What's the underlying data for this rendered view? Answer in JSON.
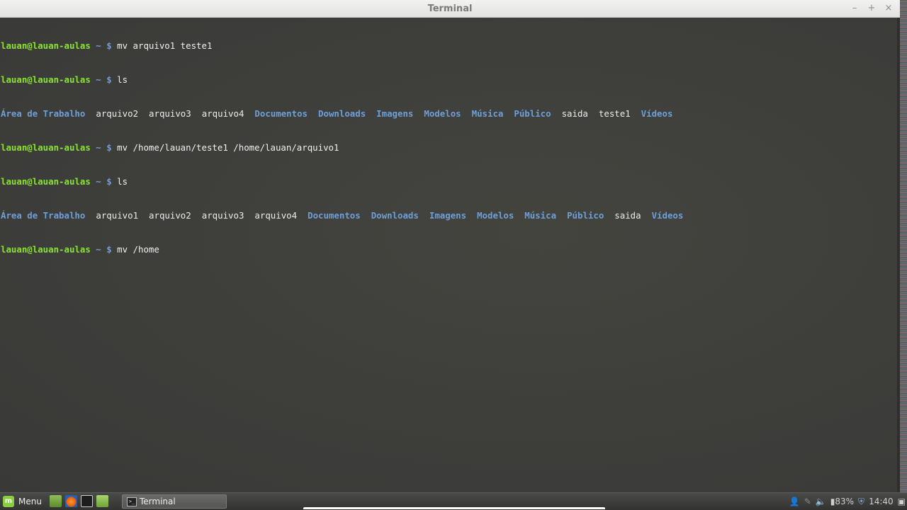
{
  "window": {
    "title": "Terminal",
    "controls": {
      "minimize": "–",
      "maximize": "+",
      "close": "×"
    }
  },
  "terminal": {
    "prompt_user": "lauan@lauan-aulas",
    "prompt_path": "~ $",
    "commands": [
      "mv arquivo1 teste1",
      "ls",
      "mv /home/lauan/teste1 /home/lauan/arquivo1",
      "ls",
      "mv /home"
    ],
    "ls1": [
      {
        "name": "Área de Trabalho",
        "type": "dir"
      },
      {
        "name": "arquivo2",
        "type": "file"
      },
      {
        "name": "arquivo3",
        "type": "file"
      },
      {
        "name": "arquivo4",
        "type": "file"
      },
      {
        "name": "Documentos",
        "type": "dir"
      },
      {
        "name": "Downloads",
        "type": "dir"
      },
      {
        "name": "Imagens",
        "type": "dir"
      },
      {
        "name": "Modelos",
        "type": "dir"
      },
      {
        "name": "Música",
        "type": "dir"
      },
      {
        "name": "Público",
        "type": "dir"
      },
      {
        "name": "saida",
        "type": "file"
      },
      {
        "name": "teste1",
        "type": "file"
      },
      {
        "name": "Vídeos",
        "type": "dir"
      }
    ],
    "ls2": [
      {
        "name": "Área de Trabalho",
        "type": "dir"
      },
      {
        "name": "arquivo1",
        "type": "file"
      },
      {
        "name": "arquivo2",
        "type": "file"
      },
      {
        "name": "arquivo3",
        "type": "file"
      },
      {
        "name": "arquivo4",
        "type": "file"
      },
      {
        "name": "Documentos",
        "type": "dir"
      },
      {
        "name": "Downloads",
        "type": "dir"
      },
      {
        "name": "Imagens",
        "type": "dir"
      },
      {
        "name": "Modelos",
        "type": "dir"
      },
      {
        "name": "Música",
        "type": "dir"
      },
      {
        "name": "Público",
        "type": "dir"
      },
      {
        "name": "saida",
        "type": "file"
      },
      {
        "name": "Vídeos",
        "type": "dir"
      }
    ]
  },
  "taskbar": {
    "menu_label": "Menu",
    "task_label": "Terminal",
    "battery": "83%",
    "clock": "14:40"
  },
  "colors": {
    "prompt_user": "#8ae234",
    "prompt_path": "#729fcf",
    "directory": "#6f9fd8",
    "terminal_bg": "#3c3c3a"
  }
}
